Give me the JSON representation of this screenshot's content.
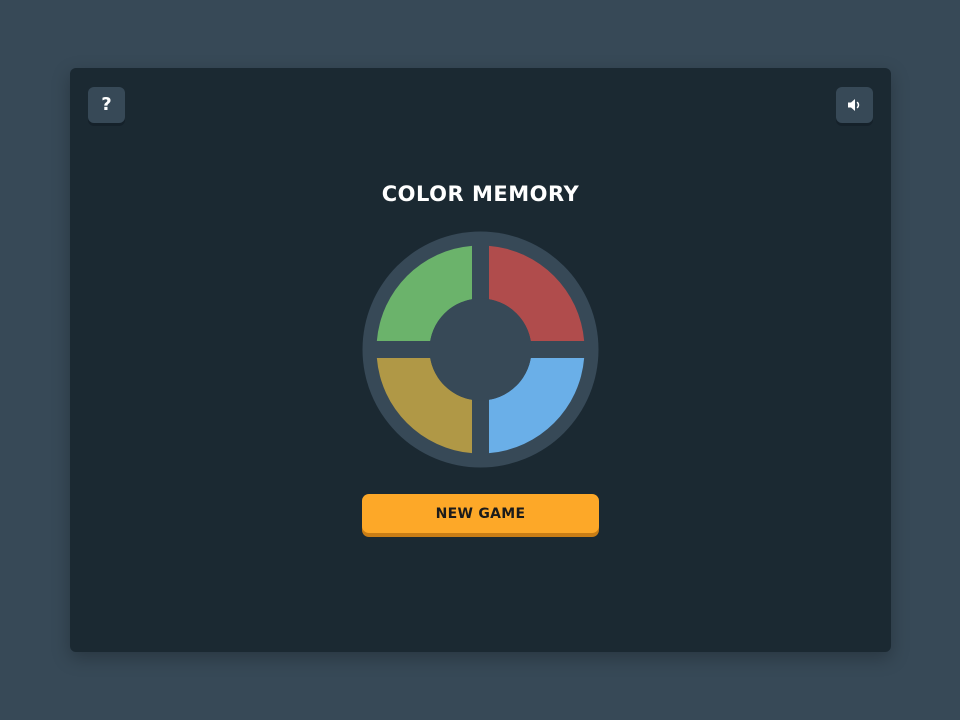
{
  "game": {
    "title": "COLOR MEMORY",
    "new_game_label": "NEW GAME",
    "help_glyph": "?"
  },
  "board": {
    "pads": [
      {
        "name": "green",
        "color": "#6bb36b"
      },
      {
        "name": "red",
        "color": "#b04c4c"
      },
      {
        "name": "yellow",
        "color": "#b09846"
      },
      {
        "name": "blue",
        "color": "#6aafe8"
      }
    ],
    "ring_color": "#374957",
    "hub_color": "#374957"
  },
  "colors": {
    "background": "#374957",
    "panel": "#1b2932",
    "button": "#fda828",
    "icon_button": "#374957"
  },
  "icons": {
    "help": "question-mark-icon",
    "sound": "speaker-icon"
  }
}
